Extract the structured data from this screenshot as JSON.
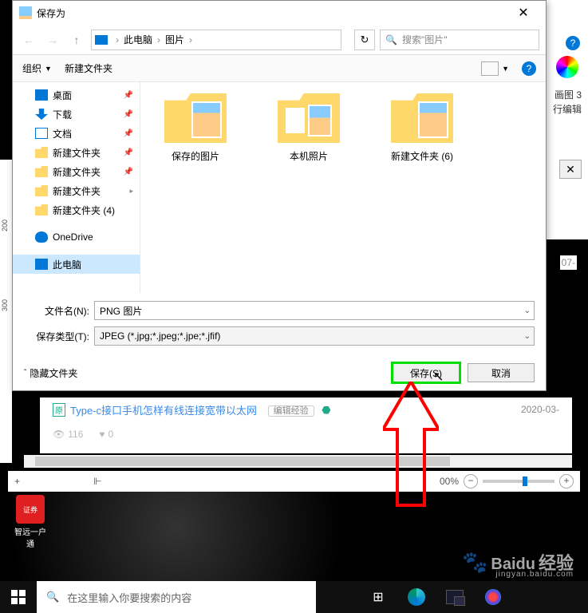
{
  "dialog": {
    "title": "保存为",
    "breadcrumb": {
      "root": "此电脑",
      "folder": "图片"
    },
    "search_placeholder": "搜索\"图片\"",
    "toolbar": {
      "organize": "组织",
      "newfolder": "新建文件夹"
    },
    "sidebar": [
      {
        "key": "desktop",
        "label": "桌面",
        "icon": "desktop",
        "pin": true
      },
      {
        "key": "downloads",
        "label": "下载",
        "icon": "download",
        "pin": true
      },
      {
        "key": "documents",
        "label": "文档",
        "icon": "doc",
        "pin": true
      },
      {
        "key": "nf1",
        "label": "新建文件夹",
        "icon": "folder",
        "pin": true
      },
      {
        "key": "nf2",
        "label": "新建文件夹",
        "icon": "folder",
        "pin": true
      },
      {
        "key": "nf3",
        "label": "新建文件夹",
        "icon": "folder",
        "pin": "expand"
      },
      {
        "key": "nf4",
        "label": "新建文件夹 (4)",
        "icon": "folder",
        "pin": false
      },
      {
        "key": "onedrive",
        "label": "OneDrive",
        "icon": "onedrive",
        "pin": false,
        "gap": true
      },
      {
        "key": "thispc",
        "label": "此电脑",
        "icon": "pc",
        "pin": false,
        "gap": true,
        "selected": true
      }
    ],
    "folders": [
      {
        "key": "saved",
        "label": "保存的图片",
        "variant": "with-pic"
      },
      {
        "key": "camera",
        "label": "本机照片",
        "variant": "with-pics"
      },
      {
        "key": "nf6",
        "label": "新建文件夹 (6)",
        "variant": "with-pic"
      }
    ],
    "filename_label": "文件名(N):",
    "filename_value": "PNG 图片",
    "filetype_label": "保存类型(T):",
    "filetype_value": "JPEG (*.jpg;*.jpeg;*.jpe;*.jfif)",
    "hide_folders": "隐藏文件夹",
    "save_btn": "保存(S)",
    "cancel_btn": "取消"
  },
  "bg": {
    "label1": "画图 3",
    "label2": "行编辑",
    "date_partial": "07-"
  },
  "article": {
    "title": "Type-c接口手机怎样有线连接宽带以太网",
    "badge": "编辑经验",
    "date": "2020-03-",
    "views": "116",
    "likes": "0"
  },
  "statusbar": {
    "plus": "+",
    "zoom": "00%"
  },
  "desktop_icon": {
    "label": "智远一户通",
    "inner": "证券"
  },
  "watermark": {
    "brand": "Baidu",
    "sub": "经验",
    "url": "jingyan.baidu.com"
  },
  "taskbar": {
    "search_placeholder": "在这里输入你要搜索的内容"
  }
}
